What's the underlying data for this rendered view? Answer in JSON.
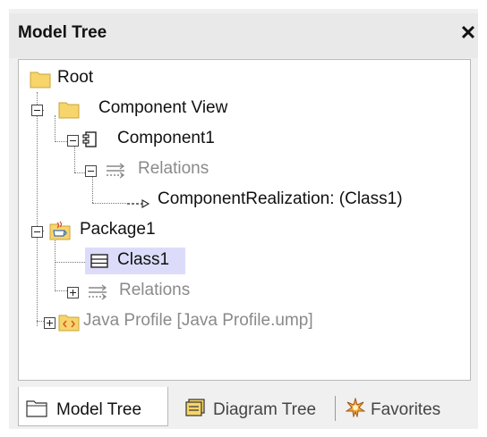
{
  "panel": {
    "title": "Model Tree",
    "close_glyph": "✕"
  },
  "tree": {
    "root": "Root",
    "component_view": "Component View",
    "component1": "Component1",
    "relations_1": "Relations",
    "component_realization": "ComponentRealization:  (Class1)",
    "package1": "Package1",
    "class1": "Class1",
    "relations_2": "Relations",
    "java_profile": "Java Profile [Java Profile.ump]"
  },
  "tabs": [
    {
      "label": "Model Tree",
      "icon": "folder-icon",
      "active": true
    },
    {
      "label": "Diagram Tree",
      "icon": "diagram-tree-icon",
      "active": false
    },
    {
      "label": "Favorites",
      "icon": "favorites-icon",
      "active": false
    }
  ],
  "colors": {
    "folder": "#f7d56b",
    "selection": "#dcdcfa",
    "grayed_text": "#8a8a8a"
  }
}
